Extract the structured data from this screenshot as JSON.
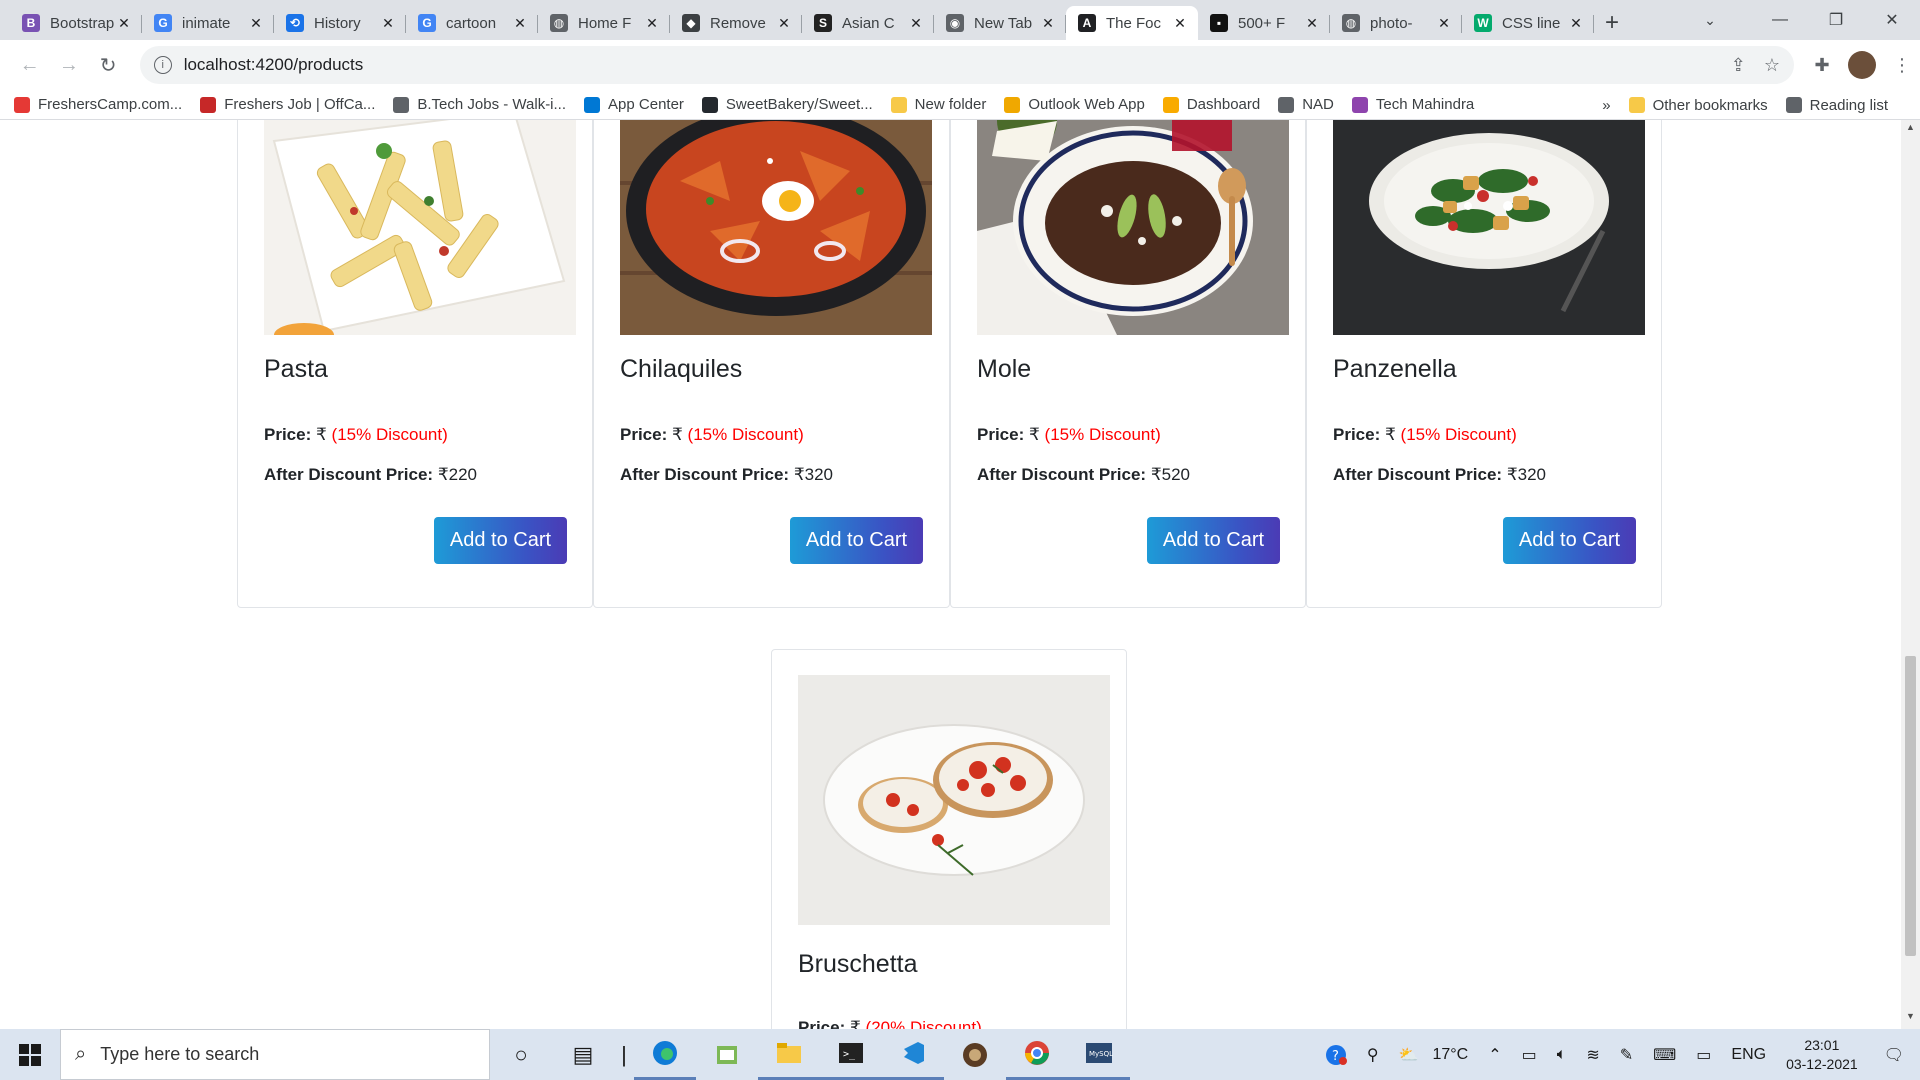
{
  "browser": {
    "tabs": [
      {
        "title": "Bootstrap",
        "icon": "bootstrap-icon",
        "color": "#7952b3"
      },
      {
        "title": "inimate",
        "icon": "google-icon",
        "color": "#4285f4"
      },
      {
        "title": "History",
        "icon": "history-icon",
        "color": "#1a73e8"
      },
      {
        "title": "cartoon",
        "icon": "google-icon",
        "color": "#4285f4"
      },
      {
        "title": "Home F",
        "icon": "globe-icon",
        "color": "#5f6368"
      },
      {
        "title": "Remove",
        "icon": "remove-bg-icon",
        "color": "#3c4043"
      },
      {
        "title": "Asian C",
        "icon": "shutterstock-icon",
        "color": "#222"
      },
      {
        "title": "New Tab",
        "icon": "chrome-icon",
        "color": "#5f6368"
      },
      {
        "title": "The Foc",
        "icon": "angular-icon",
        "color": "#202124"
      },
      {
        "title": "500+ F",
        "icon": "unsplash-icon",
        "color": "#111"
      },
      {
        "title": "photo-",
        "icon": "globe-icon",
        "color": "#5f6368"
      },
      {
        "title": "CSS line",
        "icon": "w3schools-icon",
        "color": "#04aa6d"
      }
    ],
    "active_tab_index": 8,
    "url": "localhost:4200/products",
    "bookmarks": [
      {
        "label": "FreshersCamp.com...",
        "icon": "fresherscamp-icon",
        "color": "#e53935"
      },
      {
        "label": "Freshers Job | OffCa...",
        "icon": "offcampus-icon",
        "color": "#c62828"
      },
      {
        "label": "B.Tech Jobs - Walk-i...",
        "icon": "globe-icon",
        "color": "#5f6368"
      },
      {
        "label": "App Center",
        "icon": "app-center-icon",
        "color": "#0078d4"
      },
      {
        "label": "SweetBakery/Sweet...",
        "icon": "github-icon",
        "color": "#24292e"
      },
      {
        "label": "New folder",
        "icon": "folder-icon",
        "color": "#f7c948"
      },
      {
        "label": "Outlook Web App",
        "icon": "outlook-icon",
        "color": "#f0a800"
      },
      {
        "label": "Dashboard",
        "icon": "dashboard-icon",
        "color": "#f9ab00"
      },
      {
        "label": "NAD",
        "icon": "globe-icon",
        "color": "#5f6368"
      },
      {
        "label": "Tech Mahindra",
        "icon": "tech-mahindra-icon",
        "color": "#8e44ad"
      }
    ],
    "bookmarks_more": "»",
    "other_bookmarks": "Other bookmarks",
    "reading_list": "Reading list"
  },
  "products": [
    {
      "name": "Pasta",
      "price_label": "Price:",
      "price_value": "₹",
      "discount": "(15% Discount)",
      "after_label": "After Discount Price:",
      "after_value": "₹220",
      "button": "Add to Cart"
    },
    {
      "name": "Chilaquiles",
      "price_label": "Price:",
      "price_value": "₹",
      "discount": "(15% Discount)",
      "after_label": "After Discount Price:",
      "after_value": "₹320",
      "button": "Add to Cart"
    },
    {
      "name": "Mole",
      "price_label": "Price:",
      "price_value": "₹",
      "discount": "(15% Discount)",
      "after_label": "After Discount Price:",
      "after_value": "₹520",
      "button": "Add to Cart"
    },
    {
      "name": "Panzenella",
      "price_label": "Price:",
      "price_value": "₹",
      "discount": "(15% Discount)",
      "after_label": "After Discount Price:",
      "after_value": "₹320",
      "button": "Add to Cart"
    },
    {
      "name": "Bruschetta",
      "price_label": "Price:",
      "price_value": "₹",
      "discount": "(20% Discount)"
    }
  ],
  "taskbar": {
    "search_placeholder": "Type here to search",
    "temperature": "17°C",
    "language": "ENG",
    "time": "23:01",
    "date": "03-12-2021"
  },
  "colors": {
    "discount_red": "#ff0000",
    "button_gradient_start": "#1e9bd7",
    "button_gradient_end": "#4b3bb5"
  }
}
